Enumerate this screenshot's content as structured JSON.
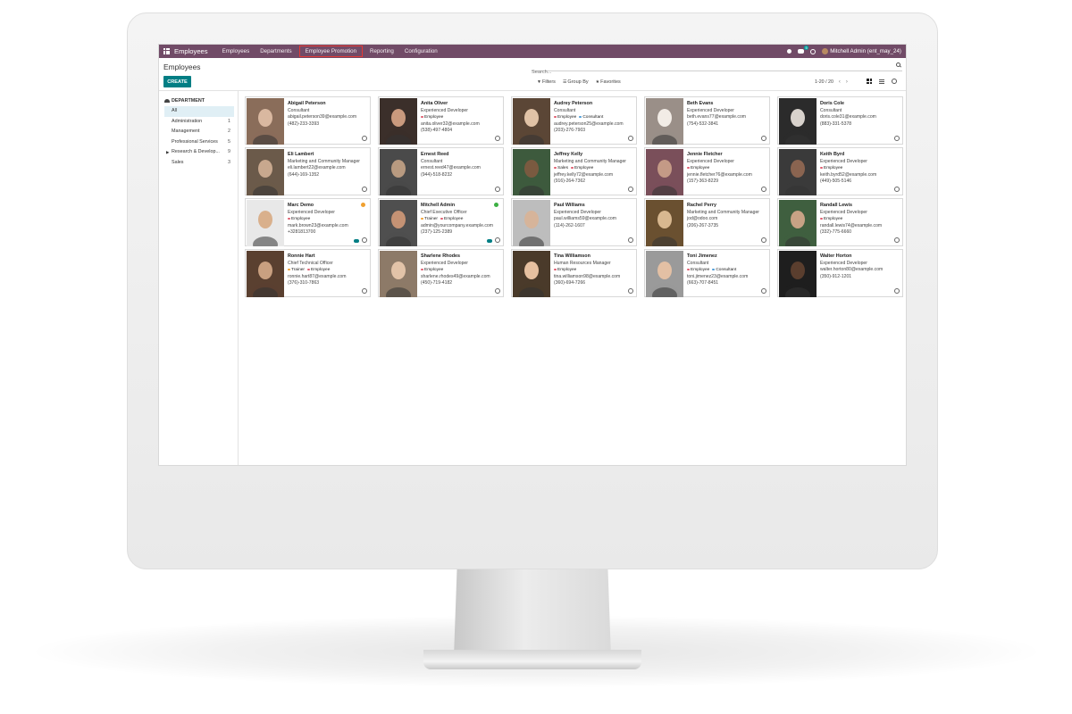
{
  "navbar": {
    "app_name": "Employees",
    "menus": [
      "Employees",
      "Departments",
      "Employee Promotion",
      "Reporting",
      "Configuration"
    ],
    "chat_badge": "5",
    "user": "Mitchell Admin (ent_may_24)",
    "color": "#714b67"
  },
  "control_panel": {
    "title": "Employees",
    "search_placeholder": "Search...",
    "create_label": "CREATE",
    "filters_label": "Filters",
    "groupby_label": "Group By",
    "favorites_label": "Favorites",
    "pager": "1-20 / 20",
    "accent": "#017e84"
  },
  "sidepanel": {
    "header": "DEPARTMENT",
    "items": [
      {
        "label": "All",
        "count": ""
      },
      {
        "label": "Administration",
        "count": "1"
      },
      {
        "label": "Management",
        "count": "2"
      },
      {
        "label": "Professional Services",
        "count": "5"
      },
      {
        "label": "Research & Develop...",
        "count": "9"
      },
      {
        "label": "Sales",
        "count": "3"
      }
    ]
  },
  "employees": [
    {
      "name": "Abigail Peterson",
      "job": "Consultant",
      "email": "abigail.peterson39@example.com",
      "phone": "(482)-233-3393",
      "tags": []
    },
    {
      "name": "Anita Oliver",
      "job": "Experienced Developer",
      "email": "anita.oliver32@example.com",
      "phone": "(538)-497-4804",
      "tags": [
        "Employee"
      ]
    },
    {
      "name": "Audrey Peterson",
      "job": "Consultant",
      "email": "audrey.peterson25@example.com",
      "phone": "(203)-276-7903",
      "tags": [
        "Employee",
        "Consultant"
      ]
    },
    {
      "name": "Beth Evans",
      "job": "Experienced Developer",
      "email": "beth.evans77@example.com",
      "phone": "(754)-532-3841",
      "tags": []
    },
    {
      "name": "Doris Cole",
      "job": "Consultant",
      "email": "doris.cole31@example.com",
      "phone": "(883)-331-5378",
      "tags": []
    },
    {
      "name": "Eli Lambert",
      "job": "Marketing and Community Manager",
      "email": "eli.lambert22@example.com",
      "phone": "(644)-169-1352",
      "tags": []
    },
    {
      "name": "Ernest Reed",
      "job": "Consultant",
      "email": "ernest.reed47@example.com",
      "phone": "(944)-518-8232",
      "tags": []
    },
    {
      "name": "Jeffrey Kelly",
      "job": "Marketing and Community Manager",
      "email": "jeffrey.kelly72@example.com",
      "phone": "(916)-264-7362",
      "tags": [
        "Sales",
        "Employee"
      ]
    },
    {
      "name": "Jennie Fletcher",
      "job": "Experienced Developer",
      "email": "jennie.fletcher76@example.com",
      "phone": "(157)-363-8229",
      "tags": [
        "Employee"
      ]
    },
    {
      "name": "Keith Byrd",
      "job": "Experienced Developer",
      "email": "keith.byrd52@example.com",
      "phone": "(449)-505-5146",
      "tags": [
        "Employee"
      ]
    },
    {
      "name": "Marc Demo",
      "job": "Experienced Developer",
      "email": "mark.brown23@example.com",
      "phone": "+3281813700",
      "tags": [
        "Employee"
      ]
    },
    {
      "name": "Mitchell Admin",
      "job": "Chief Executive Officer",
      "email": "admin@yourcompany.example.com",
      "phone": "(237)-125-2389",
      "tags": [
        "Trainer",
        "Employee"
      ]
    },
    {
      "name": "Paul Williams",
      "job": "Experienced Developer",
      "email": "paul.williams59@example.com",
      "phone": "(114)-262-1607",
      "tags": []
    },
    {
      "name": "Rachel Perry",
      "job": "Marketing and Community Manager",
      "email": "jod@odoo.com",
      "phone": "(206)-267-3735",
      "tags": []
    },
    {
      "name": "Randall Lewis",
      "job": "Experienced Developer",
      "email": "randall.lewis74@example.com",
      "phone": "(332)-775-6660",
      "tags": [
        "Employee"
      ]
    },
    {
      "name": "Ronnie Hart",
      "job": "Chief Technical Officer",
      "email": "ronnie.hart87@example.com",
      "phone": "(376)-310-7863",
      "tags": [
        "Trainer",
        "Employee"
      ]
    },
    {
      "name": "Sharlene Rhodes",
      "job": "Experienced Developer",
      "email": "sharlene.rhodes49@example.com",
      "phone": "(450)-719-4182",
      "tags": [
        "Employee"
      ]
    },
    {
      "name": "Tina Williamson",
      "job": "Human Resources Manager",
      "email": "tina.williamson98@example.com",
      "phone": "(360)-694-7266",
      "tags": [
        "Employee"
      ]
    },
    {
      "name": "Toni Jimenez",
      "job": "Consultant",
      "email": "toni.jimenez23@example.com",
      "phone": "(663)-707-8451",
      "tags": [
        "Employee",
        "Consultant"
      ]
    },
    {
      "name": "Walter Horton",
      "job": "Experienced Developer",
      "email": "walter.horton80@example.com",
      "phone": "(350)-912-1201",
      "tags": []
    }
  ],
  "tag_colors": {
    "Employee": "#e05d6f",
    "Consultant": "#4f9ed8",
    "Sales": "#e05d6f",
    "Trainer": "#f0a030"
  },
  "status_colors": {
    "Marc Demo": "#f0a030",
    "Mitchell Admin": "#3cb043"
  }
}
